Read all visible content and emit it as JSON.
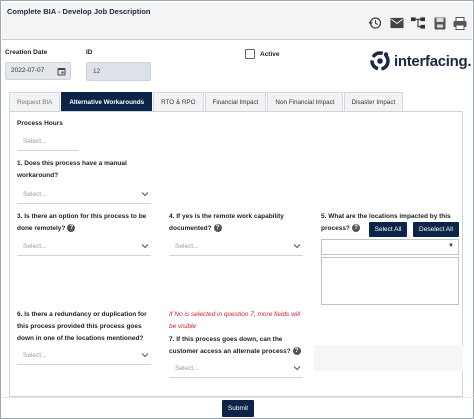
{
  "window": {
    "title": "Complete BIA - Develop Job Description"
  },
  "toolbar": {
    "icons": [
      "history-icon",
      "email-icon",
      "workflow-icon",
      "save-icon",
      "print-icon"
    ]
  },
  "header": {
    "creation_date_label": "Creation Date",
    "creation_date_value": "2022-07-07",
    "id_label": "ID",
    "id_value": "12",
    "active_label": "Active",
    "logo_text": "interfacing."
  },
  "tabs": [
    {
      "label": "Request BIA",
      "state": "disabled"
    },
    {
      "label": "Alternative Workarounds",
      "state": "active"
    },
    {
      "label": "RTO & RPO",
      "state": "normal"
    },
    {
      "label": "Financial Impact",
      "state": "normal"
    },
    {
      "label": "Non Financial Impact",
      "state": "normal"
    },
    {
      "label": "Disaster Impact",
      "state": "normal"
    }
  ],
  "form": {
    "process_hours_label": "Process Hours",
    "select_placeholder": "Select...",
    "q1_label": "1. Does this process have a manual workaround?",
    "q3_label": "3. Is there an option for this process to be done remotely?",
    "q4_label": "4. If yes is the remote work capability documented?",
    "q5_label": "5. What are the locations impacted by this process?",
    "select_all_label": "Select All",
    "deselect_all_label": "Deselect All",
    "q6_label": "6. Is there a redundancy or duplication for this process provided this process goes down in one of the locations mentioned?",
    "note_text": "If No is selected in question 7, more fields will be visible",
    "q7_label": "7. If this process goes down, can the customer access an alternate process?"
  },
  "footer": {
    "submit_label": "Submit"
  },
  "colors": {
    "navy": "#0c2448",
    "note_red": "#d2232a"
  }
}
